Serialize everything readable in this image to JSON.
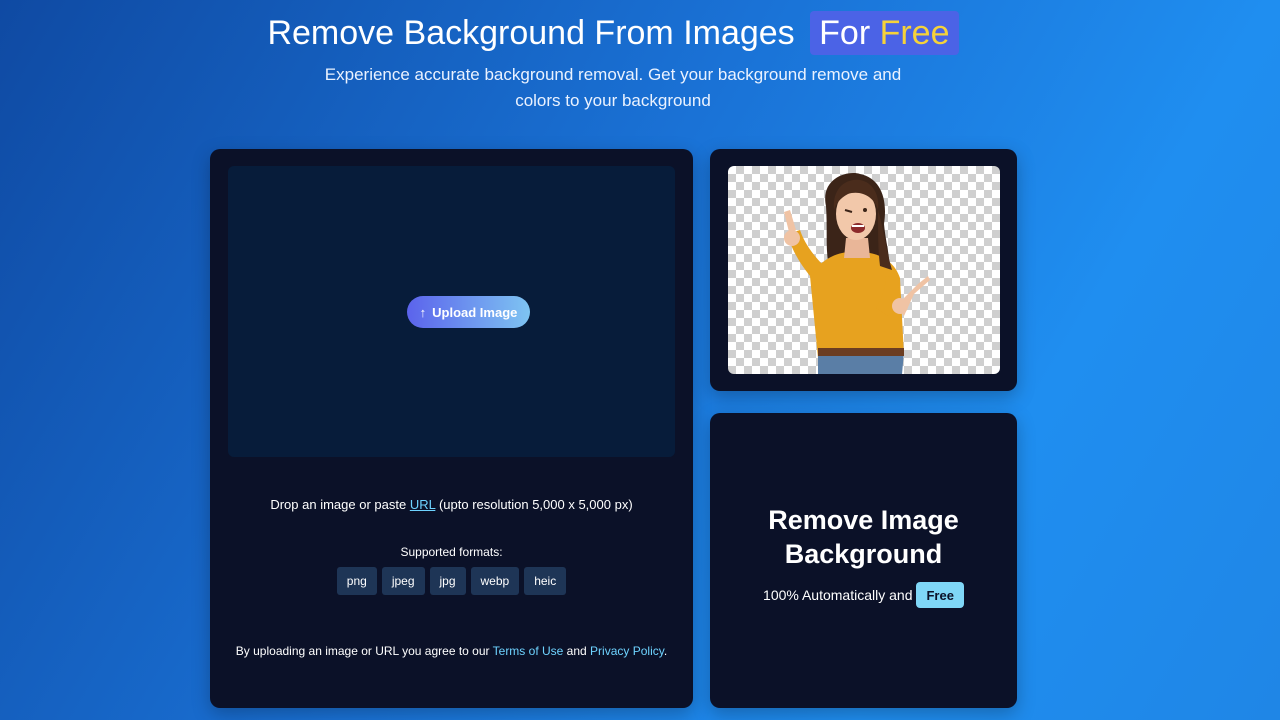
{
  "hero": {
    "title_main": "Remove Background From Images",
    "title_for": "For",
    "title_free": "Free",
    "subtitle_line1": "Experience accurate background removal. Get your background remove and",
    "subtitle_line2": "colors to your background"
  },
  "upload": {
    "button_label": "Upload Image",
    "drop_prefix": "Drop an image or paste",
    "drop_link": "URL",
    "drop_suffix": "(upto resolution 5,000 x 5,000 px)",
    "formats_label": "Supported formats:",
    "formats": [
      "png",
      "jpeg",
      "jpg",
      "webp",
      "heic"
    ],
    "terms_prefix": "By uploading an image or URL you agree to our",
    "terms_link": "Terms of Use",
    "terms_and": "and",
    "privacy_link": "Privacy Policy",
    "terms_end": "."
  },
  "info": {
    "title_line1": "Remove Image",
    "title_line2": "Background",
    "tagline": "100% Automatically and",
    "badge": "Free"
  },
  "colors": {
    "accent_free": "#f5d23a",
    "highlight_bg": "#4b63e6",
    "link": "#6ed3ff",
    "card_bg": "#0b1128"
  }
}
